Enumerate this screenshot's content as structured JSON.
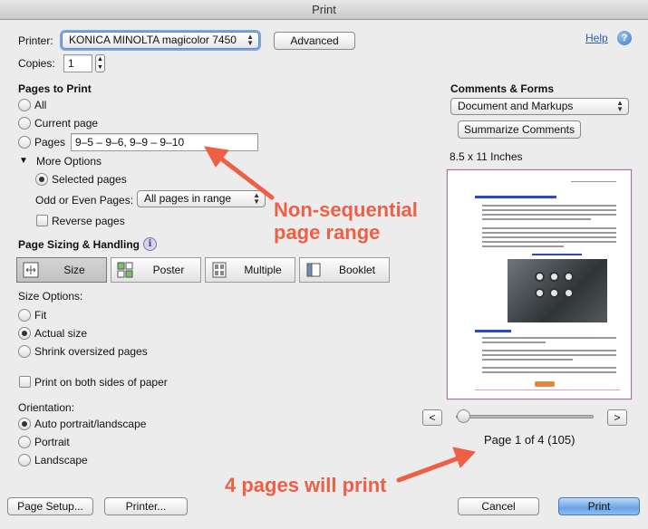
{
  "window": {
    "title": "Print"
  },
  "printer": {
    "label": "Printer:",
    "selected": "KONICA MINOLTA magicolor 7450",
    "advanced_label": "Advanced"
  },
  "copies": {
    "label": "Copies:",
    "value": "1"
  },
  "help": {
    "link_text": "Help",
    "icon_glyph": "?"
  },
  "pages_to_print": {
    "heading": "Pages to Print",
    "all_label": "All",
    "current_label": "Current page",
    "pages_label": "Pages",
    "pages_value": "9–5 – 9–6, 9–9 – 9–10",
    "more_options_label": "More Options",
    "selected_pages_label": "Selected pages",
    "odd_even_label": "Odd or Even Pages:",
    "odd_even_value": "All pages in range",
    "reverse_label": "Reverse pages"
  },
  "sizing": {
    "heading": "Page Sizing & Handling",
    "tabs": {
      "size": "Size",
      "poster": "Poster",
      "multiple": "Multiple",
      "booklet": "Booklet"
    },
    "size_options_label": "Size Options:",
    "fit_label": "Fit",
    "actual_label": "Actual size",
    "shrink_label": "Shrink oversized pages",
    "both_sides_label": "Print on both sides of paper"
  },
  "orientation": {
    "heading": "Orientation:",
    "auto_label": "Auto portrait/landscape",
    "portrait_label": "Portrait",
    "landscape_label": "Landscape"
  },
  "comments": {
    "heading": "Comments & Forms",
    "selected": "Document and Markups",
    "summarize_label": "Summarize Comments"
  },
  "preview": {
    "paper_size": "8.5 x 11 Inches",
    "prev_glyph": "<",
    "next_glyph": ">",
    "page_status": "Page 1 of 4 (105)"
  },
  "annotations": {
    "range_note_line1": "Non-sequential",
    "range_note_line2": "page range",
    "count_note": "4 pages will print",
    "color": "#ee5f45"
  },
  "footer": {
    "page_setup_label": "Page Setup...",
    "printer_label": "Printer...",
    "cancel_label": "Cancel",
    "print_label": "Print"
  }
}
